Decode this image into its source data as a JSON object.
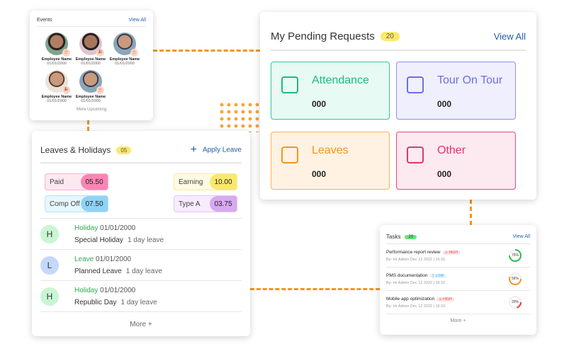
{
  "events": {
    "title": "Events",
    "view_all": "View All",
    "more": "More Upcoming",
    "people": [
      {
        "name": "Employee Name",
        "date": "01/01/2000"
      },
      {
        "name": "Employee Name",
        "date": "01/01/2000"
      },
      {
        "name": "Employee Name",
        "date": "01/01/2000"
      },
      {
        "name": "Employee Name",
        "date": "01/01/2000"
      },
      {
        "name": "Employee Name",
        "date": "01/01/2000"
      }
    ]
  },
  "leaves": {
    "title": "Leaves & Holidays",
    "count": "05",
    "apply": "Apply Leave",
    "more": "More +",
    "balances": [
      {
        "label": "Paid",
        "value": "05.50",
        "color": "#f986b4"
      },
      {
        "label": "Earning",
        "value": "10.00",
        "color": "#f9e86e"
      },
      {
        "label": "Comp Off",
        "value": "07.50",
        "color": "#8fd3f7"
      },
      {
        "label": "Type A",
        "value": "03.75",
        "color": "#d8a8f0"
      }
    ],
    "items": [
      {
        "initial": "H",
        "type": "Holiday",
        "date": "01/01/2000",
        "name": "Special Holiday",
        "duration": "1 day leave"
      },
      {
        "initial": "L",
        "type": "Leave",
        "date": "01/01/2000",
        "name": "Planned Leave",
        "duration": "1 day leave"
      },
      {
        "initial": "H",
        "type": "Holiday",
        "date": "01/01/2000",
        "name": "Republic Day",
        "duration": "1 day leave"
      }
    ]
  },
  "pending": {
    "title": "My Pending Requests",
    "count": "20",
    "view_all": "View All",
    "tiles": [
      {
        "label": "Attendance",
        "count": "000",
        "icon": "calendar-icon"
      },
      {
        "label": "Tour On Tour",
        "count": "000",
        "icon": "briefcase-icon"
      },
      {
        "label": "Leaves",
        "count": "000",
        "icon": "calendar-check-icon"
      },
      {
        "label": "Other",
        "count": "000",
        "icon": "document-icon"
      }
    ]
  },
  "tasks": {
    "title": "Tasks",
    "count": "20",
    "view_all": "View All",
    "more": "More +",
    "items": [
      {
        "name": "Performance report review",
        "priority": "HIGH",
        "meta": "By- Hr Admin   Dec 12 2022 | 16:10",
        "progress": "75%"
      },
      {
        "name": "PMS documentation",
        "priority": "LOW",
        "meta": "By- Hr Admin   Dec 12 2022 | 16:10",
        "progress": "56%"
      },
      {
        "name": "Mobile app optimization",
        "priority": "HIGH",
        "meta": "By- Hr Admin   Dec 12 2022 | 16:10",
        "progress": "20%"
      }
    ]
  }
}
